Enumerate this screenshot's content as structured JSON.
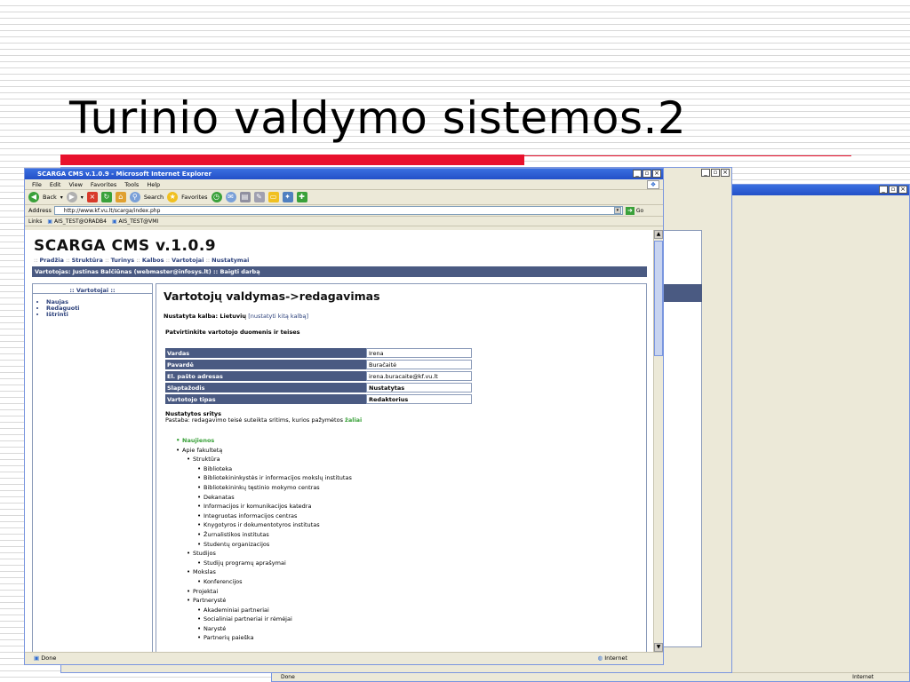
{
  "slide": {
    "title": "Turinio valdymo sistemos.2"
  },
  "browser": {
    "title": "SCARGA CMS v.1.0.9 - Microsoft Internet Explorer",
    "menu": [
      "File",
      "Edit",
      "View",
      "Favorites",
      "Tools",
      "Help"
    ],
    "toolbar": {
      "back": "Back",
      "search": "Search",
      "favorites": "Favorites"
    },
    "address_label": "Address",
    "address": "http://www.kf.vu.lt/scarga/index.php",
    "go": "Go",
    "links_label": "Links",
    "links": [
      "AIS_TEST@ORADB4",
      "AIS_TEST@VMI"
    ],
    "status": "Done",
    "zone": "Internet",
    "back_window_status": "Done",
    "back_window_zone": "Internet"
  },
  "cms": {
    "title": "SCARGA CMS v.1.0.9",
    "nav": [
      "Pradžia",
      "Struktūra",
      "Turinys",
      "Kalbos",
      "Vartotojai",
      "Nustatymai"
    ],
    "user_bar": "Vartotojas: Justinas Balčiūnas (webmaster@infosys.lt) :: Baigti darbą",
    "sidebar": {
      "heading": ":: Vartotojai ::",
      "items": [
        "Naujas",
        "Redaguoti",
        "Ištrinti"
      ]
    },
    "main": {
      "heading": "Vartotojų valdymas->redagavimas",
      "lang_label": "Nustatyta kalba: Lietuvių",
      "lang_link": "[nustatyti kitą kalbą]",
      "confirm": "Patvirtinkite vartotojo duomenis ir teises",
      "fields": [
        {
          "label": "Vardas",
          "value": "Irena"
        },
        {
          "label": "Pavardė",
          "value": "Buračaitė"
        },
        {
          "label": "El. pašto adresas",
          "value": "irena.buracaite@kf.vu.lt"
        },
        {
          "label": "Slaptažodis",
          "value": "Nustatytas"
        },
        {
          "label": "Vartotojo tipas",
          "value": "Redaktorius"
        }
      ],
      "areas_title": "Nustatytos sritys",
      "areas_note": "Pastaba: redagavimo teisė suteikta sritims, kurios pažymėtos",
      "areas_note_green": "žaliai",
      "tree": [
        {
          "text": "Naujienos",
          "level": 0,
          "green": true
        },
        {
          "text": "Apie fakultetą",
          "level": 0
        },
        {
          "text": "Struktūra",
          "level": 1
        },
        {
          "text": "Biblioteka",
          "level": 2
        },
        {
          "text": "Bibliotekininkystės ir informacijos mokslų institutas",
          "level": 2
        },
        {
          "text": "Bibliotekininkų tęstinio mokymo centras",
          "level": 2
        },
        {
          "text": "Dekanatas",
          "level": 2
        },
        {
          "text": "Informacijos ir komunikacijos katedra",
          "level": 2
        },
        {
          "text": "Integruotas informacijos centras",
          "level": 2
        },
        {
          "text": "Knygotyros ir dokumentotyros institutas",
          "level": 2
        },
        {
          "text": "Žurnalistikos institutas",
          "level": 2
        },
        {
          "text": "Studentų organizacijos",
          "level": 2
        },
        {
          "text": "Studijos",
          "level": 1
        },
        {
          "text": "Studijų programų aprašymai",
          "level": 2
        },
        {
          "text": "Mokslas",
          "level": 1
        },
        {
          "text": "Konferencijos",
          "level": 2
        },
        {
          "text": "Projektai",
          "level": 1
        },
        {
          "text": "Partnerystė",
          "level": 1
        },
        {
          "text": "Akademiniai partneriai",
          "level": 2
        },
        {
          "text": "Socialiniai partneriai ir rėmėjai",
          "level": 2
        },
        {
          "text": "Narystė",
          "level": 2
        },
        {
          "text": "Partnerių paieška",
          "level": 2
        }
      ]
    }
  },
  "colors": {
    "accent_red": "#e8112d",
    "header_blue": "#4a5a82",
    "xp_title": "#2350c8",
    "green": "#3aa13a"
  }
}
